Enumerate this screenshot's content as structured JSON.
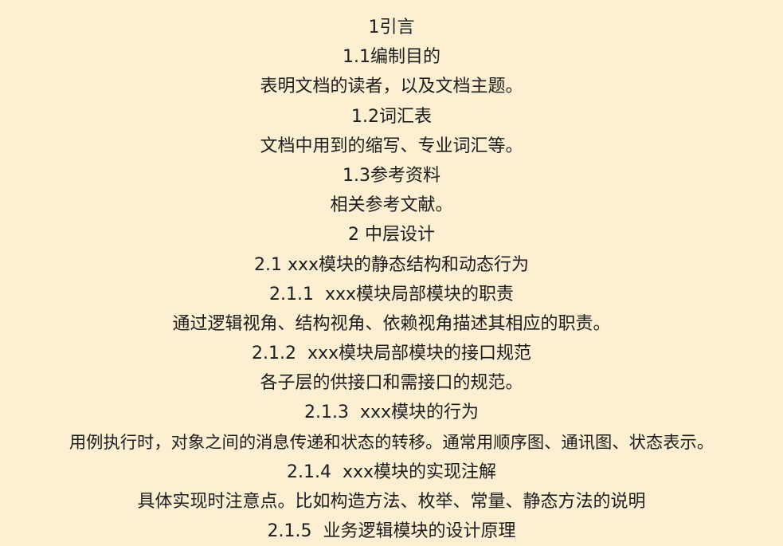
{
  "document": {
    "lines": [
      "1引言",
      "1.1编制目的",
      "表明文档的读者，以及文档主题。",
      "1.2词汇表",
      "文档中用到的缩写、专业词汇等。",
      "1.3参考资料",
      "相关参考文献。",
      "2 中层设计",
      "2.1 xxx模块的静态结构和动态行为",
      "2.1.1  xxx模块局部模块的职责",
      "通过逻辑视角、结构视角、依赖视角描述其相应的职责。",
      "2.1.2  xxx模块局部模块的接口规范",
      "各子层的供接口和需接口的规范。",
      "2.1.3  xxx模块的行为",
      "用例执行时，对象之间的消息传递和状态的转移。通常用顺序图、通讯图、状态表示。",
      "2.1.4  xxx模块的实现注解",
      "具体实现时注意点。比如构造方法、枚举、常量、静态方法的说明",
      "2.1.5  业务逻辑模块的设计原理"
    ]
  }
}
